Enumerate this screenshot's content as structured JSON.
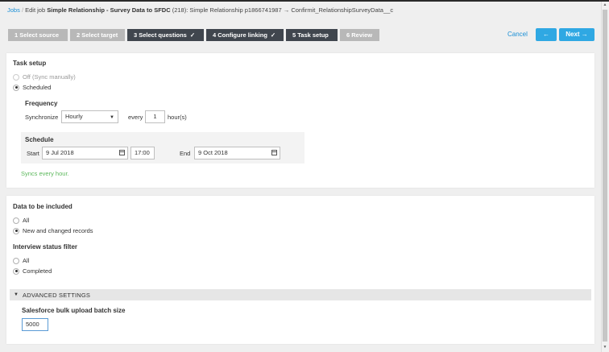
{
  "breadcrumb": {
    "root": "Jobs",
    "separator": "/",
    "edit_job_prefix": "Edit job",
    "job_name": "Simple Relationship - Survey Data to SFDC",
    "job_suffix": "(218): Simple Relationship p1866741987",
    "arrow": "→",
    "target": "Confirmit_RelationshipSurveyData__c"
  },
  "steps": [
    {
      "label": "1 Select source",
      "state": "inactive",
      "check": ""
    },
    {
      "label": "2 Select target",
      "state": "inactive",
      "check": ""
    },
    {
      "label": "3 Select questions",
      "state": "active",
      "check": "✓"
    },
    {
      "label": "4 Configure linking",
      "state": "active",
      "check": "✓"
    },
    {
      "label": "5 Task setup",
      "state": "active",
      "check": ""
    },
    {
      "label": "6 Review",
      "state": "inactive",
      "check": ""
    }
  ],
  "nav": {
    "cancel_label": "Cancel",
    "back_label": "←",
    "next_label": "Next →"
  },
  "task_setup": {
    "title": "Task setup",
    "off_label": "Off",
    "off_hint": "(Sync manually)",
    "scheduled_label": "Scheduled",
    "selected": "scheduled",
    "frequency": {
      "title": "Frequency",
      "sync_label": "Synchronize",
      "select_value": "Hourly",
      "every_label": "every",
      "every_value": "1",
      "unit_label": "hour(s)"
    },
    "schedule": {
      "title": "Schedule",
      "start_label": "Start",
      "start_date": "9 Jul 2018",
      "start_time": "17:00",
      "end_label": "End",
      "end_date": "9 Oct 2018"
    },
    "summary": "Syncs every hour."
  },
  "data_included": {
    "title": "Data to be included",
    "options": [
      {
        "label": "All",
        "checked": false
      },
      {
        "label": "New and changed records",
        "checked": true
      }
    ]
  },
  "interview_filter": {
    "title": "Interview status filter",
    "options": [
      {
        "label": "All",
        "checked": false
      },
      {
        "label": "Completed",
        "checked": true
      }
    ]
  },
  "advanced": {
    "toggle_icon": "▼",
    "title": "ADVANCED SETTINGS",
    "batch_label": "Salesforce bulk upload batch size",
    "batch_value": "5000"
  },
  "icons": {
    "calendar": "calendar-icon",
    "dropdown": "chevron-down-icon"
  },
  "colors": {
    "accent": "#2fa8e3",
    "active_step": "#40464e",
    "inactive_step": "#b8b8b8",
    "success": "#5cb85c"
  }
}
